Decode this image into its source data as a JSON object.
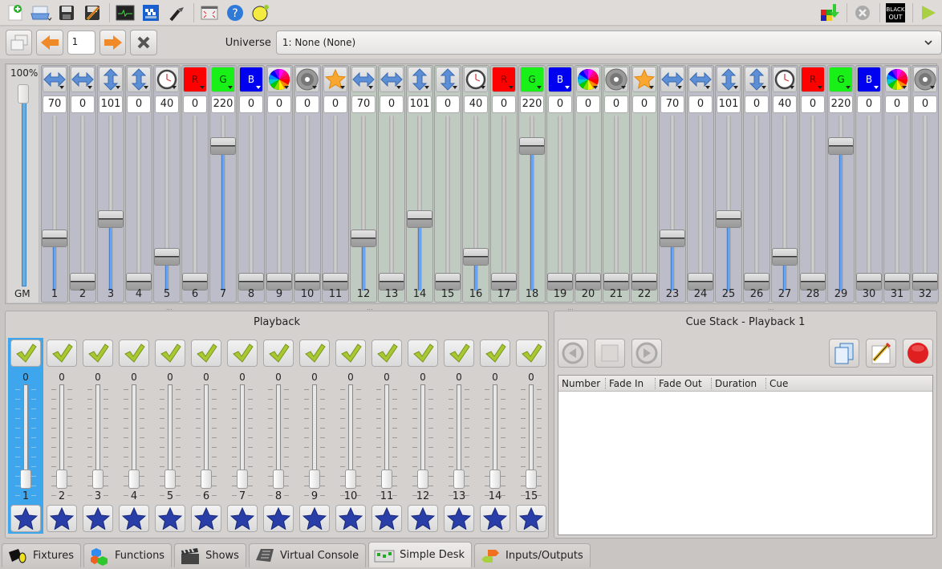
{
  "toolbar": {
    "left_buttons": [
      {
        "name": "new-workspace-icon",
        "tooltip": "New"
      },
      {
        "name": "open-workspace-icon",
        "tooltip": "Open"
      },
      {
        "name": "save-workspace-icon",
        "tooltip": "Save"
      },
      {
        "name": "save-as-icon",
        "tooltip": "Save As"
      },
      {
        "name": "monitor-icon",
        "tooltip": "Monitor"
      },
      {
        "name": "dmx-address-tool-icon",
        "tooltip": "Address Tool"
      },
      {
        "name": "flashlight-icon",
        "tooltip": "Fixtures Remap"
      },
      {
        "name": "fullscreen-icon",
        "tooltip": "Full screen"
      },
      {
        "name": "help-icon",
        "tooltip": "Help"
      },
      {
        "name": "about-icon",
        "tooltip": "About"
      }
    ],
    "right_buttons": [
      {
        "name": "dump-to-function-icon"
      },
      {
        "name": "stop-all-functions-icon"
      },
      {
        "name": "blackout-icon",
        "label_line1": "BLACK",
        "label_line2": "OUT"
      },
      {
        "name": "operate-mode-icon"
      }
    ]
  },
  "pager": {
    "page_value": "1",
    "universe_label": "Universe",
    "universe_selected": "1: None (None)"
  },
  "grand_master": {
    "top_label": "100%",
    "bottom_label": "GM",
    "level_percent": 100
  },
  "channels": [
    {
      "num": "1",
      "icon": "pan",
      "value": "70"
    },
    {
      "num": "2",
      "icon": "pan",
      "value": "0"
    },
    {
      "num": "3",
      "icon": "tilt",
      "value": "101"
    },
    {
      "num": "4",
      "icon": "tilt",
      "value": "0"
    },
    {
      "num": "5",
      "icon": "speed",
      "value": "40"
    },
    {
      "num": "6",
      "icon": "red",
      "value": "0",
      "label": "R"
    },
    {
      "num": "7",
      "icon": "green",
      "value": "220",
      "label": "G"
    },
    {
      "num": "8",
      "icon": "blue",
      "value": "0",
      "label": "B"
    },
    {
      "num": "9",
      "icon": "colorwheel",
      "value": "0"
    },
    {
      "num": "10",
      "icon": "shutter",
      "value": "0"
    },
    {
      "num": "11",
      "icon": "star",
      "value": "0"
    },
    {
      "num": "12",
      "icon": "pan",
      "value": "70"
    },
    {
      "num": "13",
      "icon": "pan",
      "value": "0"
    },
    {
      "num": "14",
      "icon": "tilt",
      "value": "101"
    },
    {
      "num": "15",
      "icon": "tilt",
      "value": "0"
    },
    {
      "num": "16",
      "icon": "speed",
      "value": "40"
    },
    {
      "num": "17",
      "icon": "red",
      "value": "0",
      "label": "R"
    },
    {
      "num": "18",
      "icon": "green",
      "value": "220",
      "label": "G"
    },
    {
      "num": "19",
      "icon": "blue",
      "value": "0",
      "label": "B"
    },
    {
      "num": "20",
      "icon": "colorwheel",
      "value": "0"
    },
    {
      "num": "21",
      "icon": "shutter",
      "value": "0"
    },
    {
      "num": "22",
      "icon": "star",
      "value": "0"
    },
    {
      "num": "23",
      "icon": "pan",
      "value": "70"
    },
    {
      "num": "24",
      "icon": "pan",
      "value": "0"
    },
    {
      "num": "25",
      "icon": "tilt",
      "value": "101"
    },
    {
      "num": "26",
      "icon": "tilt",
      "value": "0"
    },
    {
      "num": "27",
      "icon": "speed",
      "value": "40"
    },
    {
      "num": "28",
      "icon": "red",
      "value": "0",
      "label": "R"
    },
    {
      "num": "29",
      "icon": "green",
      "value": "220",
      "label": "G"
    },
    {
      "num": "30",
      "icon": "blue",
      "value": "0",
      "label": "B"
    },
    {
      "num": "31",
      "icon": "colorwheel",
      "value": "0"
    },
    {
      "num": "32",
      "icon": "shutter",
      "value": "0"
    }
  ],
  "playback": {
    "title": "Playback",
    "selected_index": 0,
    "items": [
      {
        "num": "1",
        "value": "0"
      },
      {
        "num": "2",
        "value": "0"
      },
      {
        "num": "3",
        "value": "0"
      },
      {
        "num": "4",
        "value": "0"
      },
      {
        "num": "5",
        "value": "0"
      },
      {
        "num": "6",
        "value": "0"
      },
      {
        "num": "7",
        "value": "0"
      },
      {
        "num": "8",
        "value": "0"
      },
      {
        "num": "9",
        "value": "0"
      },
      {
        "num": "10",
        "value": "0"
      },
      {
        "num": "11",
        "value": "0"
      },
      {
        "num": "12",
        "value": "0"
      },
      {
        "num": "13",
        "value": "0"
      },
      {
        "num": "14",
        "value": "0"
      },
      {
        "num": "15",
        "value": "0"
      }
    ]
  },
  "cue_stack": {
    "title": "Cue Stack - Playback 1",
    "columns": [
      "Number",
      "Fade In",
      "Fade Out",
      "Duration",
      "Cue"
    ],
    "rows": []
  },
  "tabs": [
    {
      "label": "Fixtures",
      "icon": "fixtures-icon",
      "active": false
    },
    {
      "label": "Functions",
      "icon": "functions-icon",
      "active": false
    },
    {
      "label": "Shows",
      "icon": "shows-icon",
      "active": false
    },
    {
      "label": "Virtual Console",
      "icon": "virtual-console-icon",
      "active": false
    },
    {
      "label": "Simple Desk",
      "icon": "simple-desk-icon",
      "active": true
    },
    {
      "label": "Inputs/Outputs",
      "icon": "inputs-outputs-icon",
      "active": false
    }
  ],
  "colors": {
    "selection_blue": "#3ea6ec",
    "fader_fill": "#6aa4f0",
    "check_green": "#a8c832",
    "star_blue": "#2a3ea8",
    "record_red": "#e02020"
  }
}
